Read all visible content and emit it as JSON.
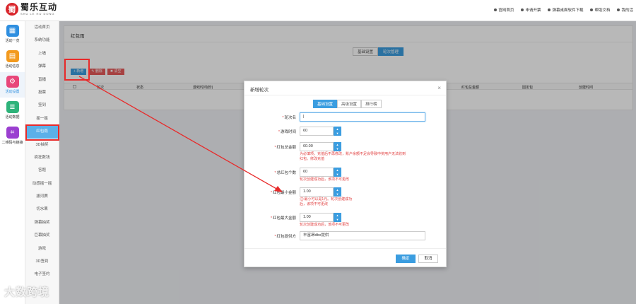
{
  "header": {
    "logo_mark": "蜀",
    "logo_cn": "蜀乐互动",
    "logo_en": "SHU LE HU DONG",
    "links": [
      "官网首页",
      "申请开票",
      "弹幕桌面软件下载",
      "帮助文档",
      "我的活"
    ]
  },
  "iconbar": [
    {
      "label": "活动一览",
      "icon": "grid-icon",
      "color": "#2f8fe0"
    },
    {
      "label": "活动信息",
      "icon": "document-icon",
      "color": "#f39a1e"
    },
    {
      "label": "活动设置",
      "icon": "gear-icon",
      "color": "#e8467a"
    },
    {
      "label": "活动数据",
      "icon": "database-icon",
      "color": "#2eb37a"
    },
    {
      "label": "二维码与链接",
      "icon": "qrcode-icon",
      "color": "#9b3fd0"
    }
  ],
  "submenu": [
    "活动首页",
    "系统功能",
    "上墙",
    "弹幕",
    "直播",
    "投票",
    "签到",
    "摇一摇",
    "红包雨",
    "3D抽奖",
    "疯狂数钱",
    "答题",
    "动感摇一摇",
    "拔河赛",
    "切水果",
    "弹幕抽奖",
    "巨幕抽奖",
    "游戏",
    "3D签到",
    "电子签约"
  ],
  "panel": {
    "title": "红包雨",
    "tabs": [
      "基础设置",
      "轮次管理"
    ],
    "actions": [
      {
        "label": "+ 新增",
        "color": "#3b9de0"
      },
      {
        "label": "✎ 删除",
        "color": "#e65a5a"
      },
      {
        "label": "✖ 清空",
        "color": "#e65a5a"
      }
    ],
    "columns": [
      "轮次",
      "状态",
      "游戏时间(秒)",
      "红包总金额",
      "固定包",
      "创建时间"
    ]
  },
  "modal": {
    "title": "新增轮次",
    "close": "×",
    "tabs": [
      "基础设置",
      "高级设置",
      "排行榜"
    ],
    "fields": [
      {
        "label": "轮次名",
        "value": "|"
      },
      {
        "label": "游戏时间",
        "value": "60"
      },
      {
        "label": "红包总金额",
        "value": "60.00"
      },
      {
        "label": "总红包个数",
        "value": "60"
      },
      {
        "label": "红包最小金额",
        "value": "1.00"
      },
      {
        "label": "红包最大金额",
        "value": "1.00"
      },
      {
        "label": "红包提供方",
        "value": "丰富昂dbx提供"
      }
    ],
    "notes": {
      "total_amount": [
        "为必填项，充值后不再修改，账户余额不足会导致中奖用户无法收到",
        "红包。修改充值"
      ],
      "count": "轮次创建成功后，该项不可更改",
      "min_amount": [
        "注:最小可以是1元。轮次创建成功",
        "后，该项不可更改"
      ],
      "max_amount": "轮次创建成功后，该项不可更改"
    },
    "ok": "确定",
    "cancel": "取消"
  },
  "watermark": "大数跨境"
}
